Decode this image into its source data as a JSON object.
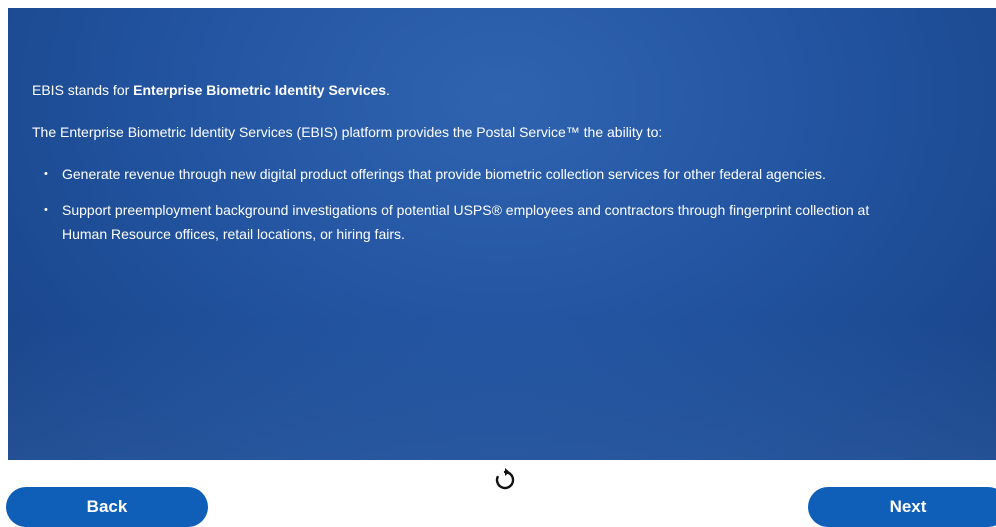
{
  "slide": {
    "intro_prefix": "EBIS stands for ",
    "intro_bold": "Enterprise Biometric Identity Services",
    "intro_suffix": ".",
    "lead": "The Enterprise Biometric Identity Services (EBIS) platform provides the Postal Service™ the ability to:",
    "bullets": [
      {
        "marker": "•",
        "text": "Generate revenue through new digital product offerings that provide biometric collection services for other federal agencies."
      },
      {
        "marker": "•",
        "text": "Support preemployment background investigations of potential USPS® employees and contractors through fingerprint collection at Human Resource offices, retail locations, or hiring fairs."
      }
    ]
  },
  "controls": {
    "replay_icon": "replay-icon",
    "back_label": "Back",
    "next_label": "Next"
  },
  "colors": {
    "slide_bg": "#2456a3",
    "button_bg": "#0f5fb9",
    "text": "#ffffff"
  }
}
